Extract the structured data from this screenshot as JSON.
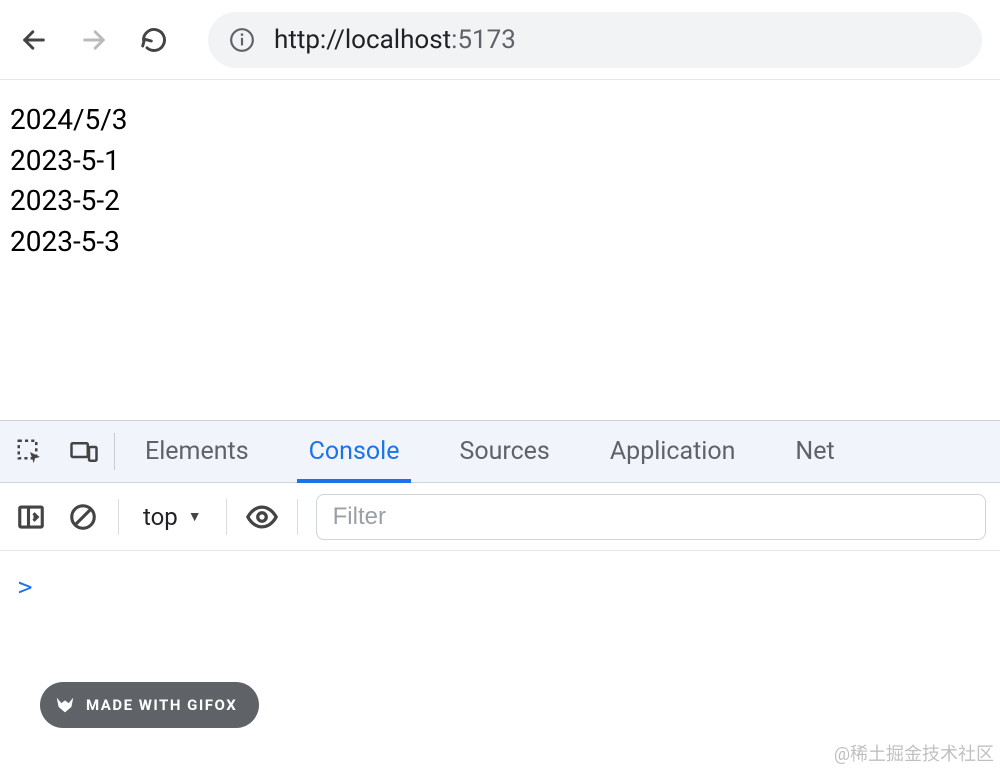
{
  "browser": {
    "url_prefix": "http://localhost",
    "url_port": ":5173"
  },
  "page": {
    "lines": [
      "2024/5/3",
      "2023-5-1",
      "2023-5-2",
      "2023-5-3"
    ]
  },
  "devtools": {
    "tabs": {
      "elements": "Elements",
      "console": "Console",
      "sources": "Sources",
      "application": "Application",
      "network": "Net"
    },
    "console": {
      "context": "top",
      "filter_placeholder": "Filter",
      "prompt": ">"
    }
  },
  "gifox": {
    "label": "MADE WITH GIFOX"
  },
  "watermark": "@稀土掘金技术社区"
}
